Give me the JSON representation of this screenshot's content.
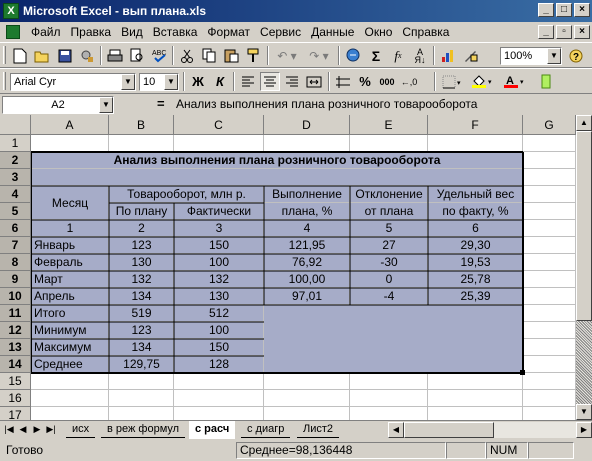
{
  "window": {
    "title": "Microsoft Excel - вып плана.xls",
    "app_icon": "excel-icon",
    "controls": [
      "_",
      "□",
      "×"
    ]
  },
  "menu": {
    "items": [
      "Файл",
      "Правка",
      "Вид",
      "Вставка",
      "Формат",
      "Сервис",
      "Данные",
      "Окно",
      "Справка"
    ],
    "doc_controls": [
      "_",
      "▫",
      "×"
    ]
  },
  "standard_toolbar": {
    "zoom": "100%",
    "icons": [
      "new-icon",
      "open-icon",
      "save-icon",
      "permission-icon",
      "print-icon",
      "print-preview-icon",
      "spelling-icon",
      "cut-icon",
      "copy-icon",
      "paste-icon",
      "format-painter-icon",
      "undo-icon",
      "redo-icon",
      "hyperlink-icon",
      "autosum-icon",
      "function-icon",
      "sort-ascending-icon",
      "chart-wizard-icon",
      "drawing-icon",
      "zoom-dropdown",
      "help-icon"
    ]
  },
  "formatting_toolbar": {
    "font": "Arial Cyr",
    "size": "10",
    "bold_label": "Ж",
    "italic_label": "К",
    "currency_label": "%",
    "comma_label": "000",
    "fill_color": "#ffff00",
    "font_color": "#ff0000"
  },
  "formula_bar": {
    "name_box": "A2",
    "equals": "=",
    "formula": "Анализ выполнения плана розничного товарооборота"
  },
  "colors": {
    "selection": "#a6acc8",
    "grid_line": "#c0c0c0"
  },
  "columns": [
    "A",
    "B",
    "C",
    "D",
    "E",
    "F",
    "G"
  ],
  "rows": [
    "1",
    "2",
    "3",
    "4",
    "5",
    "6",
    "7",
    "8",
    "9",
    "10",
    "11",
    "12",
    "13",
    "14",
    "15",
    "16",
    "17"
  ],
  "sheet": {
    "title": "Анализ выполнения плана розничного товарооборота",
    "header": {
      "month": "Месяц",
      "turnover": "Товарооборот, млн р.",
      "plan": "По плану",
      "actual": "Фактически",
      "fulfil1": "Выполнение",
      "fulfil2": "плана, %",
      "dev1": "Отклонение",
      "dev2": "от  плана",
      "share1": "Удельный вес",
      "share2": "по факту, %"
    },
    "numbers": [
      "1",
      "2",
      "3",
      "4",
      "5",
      "6"
    ],
    "data_rows": [
      [
        "Январь",
        "123",
        "150",
        "121,95",
        "27",
        "29,30"
      ],
      [
        "Февраль",
        "130",
        "100",
        "76,92",
        "-30",
        "19,53"
      ],
      [
        "Март",
        "132",
        "132",
        "100,00",
        "0",
        "25,78"
      ],
      [
        "Апрель",
        "134",
        "130",
        "97,01",
        "-4",
        "25,39"
      ]
    ],
    "summary_rows": [
      [
        "Итого",
        "519",
        "512"
      ],
      [
        "Минимум",
        "123",
        "100"
      ],
      [
        "Максимум",
        "134",
        "150"
      ],
      [
        "Среднее",
        "129,75",
        "128"
      ]
    ]
  },
  "tabs": [
    "исх",
    "в реж формул",
    "с расч",
    "с диагр",
    "Лист2"
  ],
  "active_tab": "с расч",
  "status": {
    "ready": "Готово",
    "sum": "Среднее=98,136448",
    "num": "NUM"
  }
}
